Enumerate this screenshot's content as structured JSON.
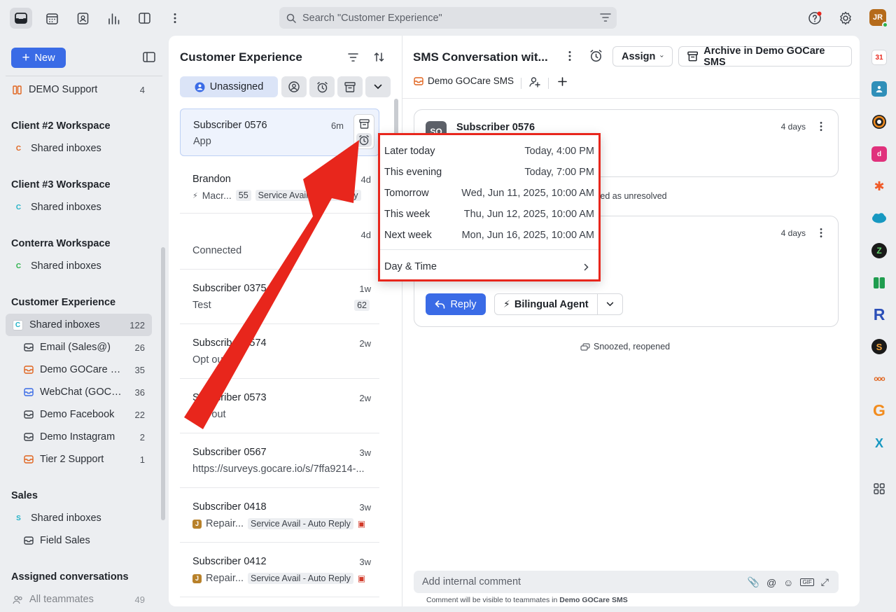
{
  "search": {
    "placeholder": "Search \"Customer Experience\""
  },
  "user": {
    "initials": "JR"
  },
  "sidebar": {
    "new_label": "New",
    "top_item": {
      "label": "DEMO Support",
      "count": "4"
    },
    "sections": [
      {
        "heading": "Client #2 Workspace",
        "badge": "C",
        "badge_color": "#e0641e",
        "item": "Shared inboxes"
      },
      {
        "heading": "Client #3 Workspace",
        "badge": "C",
        "badge_color": "#23b2c7",
        "item": "Shared inboxes"
      },
      {
        "heading": "Conterra Workspace",
        "badge": "C",
        "badge_color": "#2bb24c",
        "item": "Shared inboxes"
      }
    ],
    "cx": {
      "heading": "Customer Experience",
      "shared": {
        "badge": "C",
        "label": "Shared inboxes",
        "count": "122"
      },
      "inboxes": [
        {
          "label": "Email (Sales@)",
          "count": "26",
          "color": "#3c4149"
        },
        {
          "label": "Demo GOCare SMS",
          "count": "35",
          "color": "#e0641e"
        },
        {
          "label": "WebChat (GOCare)",
          "count": "36",
          "color": "#3a6be6"
        },
        {
          "label": "Demo Facebook",
          "count": "22",
          "color": "#3c4149"
        },
        {
          "label": "Demo Instagram",
          "count": "2",
          "color": "#3c4149"
        },
        {
          "label": "Tier 2 Support",
          "count": "1",
          "color": "#e0641e"
        }
      ]
    },
    "sales": {
      "heading": "Sales",
      "badge": "S",
      "shared": "Shared inboxes",
      "field": "Field Sales"
    },
    "assigned": {
      "heading": "Assigned conversations",
      "item": "All teammates",
      "count": "49"
    }
  },
  "list": {
    "title": "Customer Experience",
    "filter_label": "Unassigned",
    "conversations": [
      {
        "name": "Subscriber 0576",
        "time": "6m",
        "preview": "App"
      },
      {
        "name": "Brandon",
        "time": "4d",
        "preview": "Macr...",
        "num": "55",
        "tag": "Service Avail - Auto Reply"
      },
      {
        "name": "",
        "time": "4d",
        "preview": "Connected"
      },
      {
        "name": "Subscriber 0375",
        "time": "1w",
        "preview": "Test",
        "num": "62"
      },
      {
        "name": "Subscriber 0574",
        "time": "2w",
        "preview": "Opt out"
      },
      {
        "name": "Subscriber 0573",
        "time": "2w",
        "preview": "Opt out"
      },
      {
        "name": "Subscriber 0567",
        "time": "3w",
        "preview": "https://surveys.gocare.io/s/7ffa9214-..."
      },
      {
        "name": "Subscriber 0418",
        "time": "3w",
        "badge": "J",
        "preview": "Repair...",
        "tag": "Service Avail - Auto Reply"
      },
      {
        "name": "Subscriber 0412",
        "time": "3w",
        "badge": "J",
        "preview": "Repair...",
        "tag": "Service Avail - Auto Reply"
      }
    ]
  },
  "main": {
    "title": "SMS Conversation wit...",
    "assign_label": "Assign",
    "archive_label": "Archive in Demo GOCare SMS",
    "inbox_tab": "Demo GOCare SMS",
    "message1": {
      "avatar": "SO",
      "name": "Subscriber 0576",
      "time": "4 days"
    },
    "event1": "rked as unresolved",
    "message2": {
      "time": "4 days"
    },
    "reply_label": "Reply",
    "agent_label": "Bilingual Agent",
    "event2": "Snoozed, reopened",
    "comment_placeholder": "Add internal comment",
    "comment_note_prefix": "Comment will be visible to teammates in ",
    "comment_note_inbox": "Demo GOCare SMS"
  },
  "snooze": {
    "options": [
      {
        "label": "Later today",
        "when": "Today, 4:00 PM"
      },
      {
        "label": "This evening",
        "when": "Today, 7:00 PM"
      },
      {
        "label": "Tomorrow",
        "when": "Wed, Jun 11, 2025, 10:00 AM"
      },
      {
        "label": "This week",
        "when": "Thu, Jun 12, 2025, 10:00 AM"
      },
      {
        "label": "Next week",
        "when": "Mon, Jun 16, 2025, 10:00 AM"
      }
    ],
    "custom_label": "Day & Time"
  },
  "rail": {
    "calendar_day": "31",
    "r_letter": "R",
    "g_letter": "G",
    "x_letter": "X"
  },
  "colors": {
    "accent": "#3a6be6",
    "annotation": "#e8261c"
  }
}
